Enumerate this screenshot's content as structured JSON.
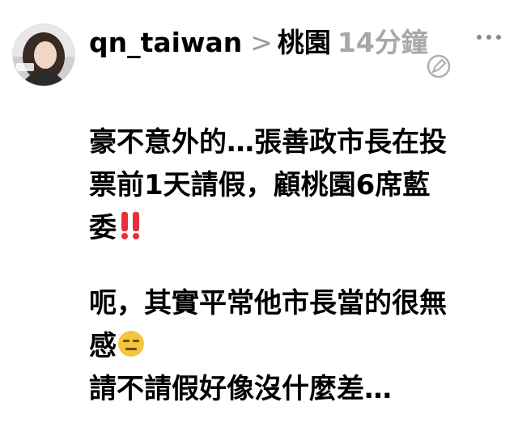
{
  "post": {
    "username": "qn_taiwan",
    "chevron": ">",
    "location": "桃園",
    "time": "14分鐘",
    "content": {
      "para1": {
        "line1": "豪不意外的…張善政市長在投",
        "line2": "票前1天請假，顧桃園6席藍",
        "line3": "委"
      },
      "para2": {
        "line1": "呃，其實平常他市長當的很無",
        "line2": "感",
        "line3": "請不請假好像沒什麼差…"
      }
    },
    "icons": {
      "avatar": "avatar-photo",
      "more": "more-dots-icon",
      "edit": "edit-pencil-icon",
      "emoji1": "double-exclamation-emoji",
      "emoji2": "expressionless-face-emoji"
    },
    "colors": {
      "text": "#000000",
      "muted": "#a8a8a8",
      "chevron": "#9a9a9a",
      "alert": "#e8303a",
      "emoji_face": "#f5c53a"
    }
  }
}
